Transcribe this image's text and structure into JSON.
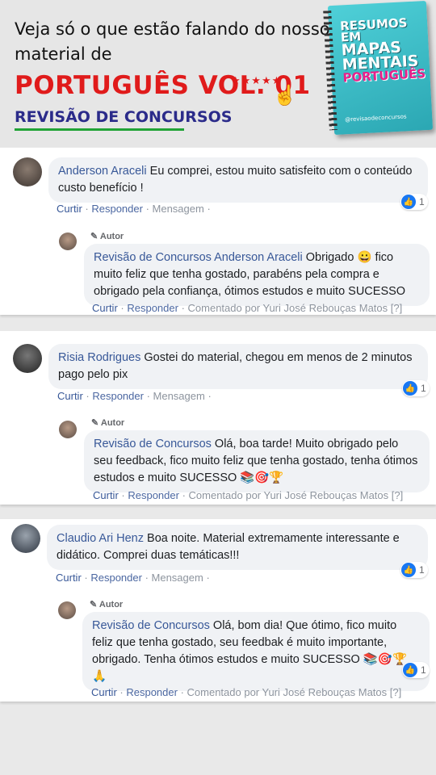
{
  "header": {
    "line1": "Veja só o que estão falando do nosso",
    "line2": "material de",
    "product": "PORTUGUÊS VOL. 01",
    "brand": "REVISÃO DE CONCURSOS",
    "stars": "★★★★★",
    "rating_stars": 5,
    "colors": {
      "product": "#e01b1b",
      "brand": "#2b2b8a",
      "underline": "#21a336"
    }
  },
  "book": {
    "t1": "RESUMOS",
    "t2": "EM",
    "t3": "MAPAS",
    "t4": "MENTAIS",
    "t5": "PORTUGUÊS",
    "handle": "@revisaodeconcursos"
  },
  "common": {
    "curtir": "Curtir",
    "responder": "Responder",
    "mensagem": "Mensagem",
    "autor": "Autor",
    "comentado_por": "Comentado por Yuri José Rebouças Matos",
    "help": "[?]",
    "sep": " · "
  },
  "comments": [
    {
      "name": "Anderson Araceli",
      "text": " Eu comprei, estou muito satisfeito com o conteúdo custo benefício !",
      "likes": "1",
      "reply": {
        "name": "Revisão de Concursos",
        "mention": "Anderson Araceli",
        "text": " Obrigado 😀 fico muito feliz que tenha gostado, parabéns pela compra e obrigado pela confiança, ótimos estudos e muito SUCESSO"
      }
    },
    {
      "name": "Risia Rodrigues",
      "text": " Gostei do material, chegou em menos de 2 minutos pago pelo pix",
      "likes": "1",
      "reply": {
        "name": "Revisão de Concursos",
        "text": " Olá, boa tarde! Muito obrigado pelo seu feedback, fico muito feliz que tenha gostado, tenha ótimos estudos e muito SUCESSO 📚🎯🏆"
      }
    },
    {
      "name": "Claudio Ari Henz",
      "text": " Boa noite. Material extremamente interessante e didático. Comprei duas temáticas!!!",
      "likes": "1",
      "reply": {
        "name": "Revisão de Concursos",
        "text": " Olá, bom dia! Que ótimo, fico muito feliz que tenha gostado, seu feedbak é muito importante, obrigado. Tenha ótimos estudos e muito SUCESSO 📚🎯🏆🙏",
        "likes": "1"
      }
    }
  ]
}
